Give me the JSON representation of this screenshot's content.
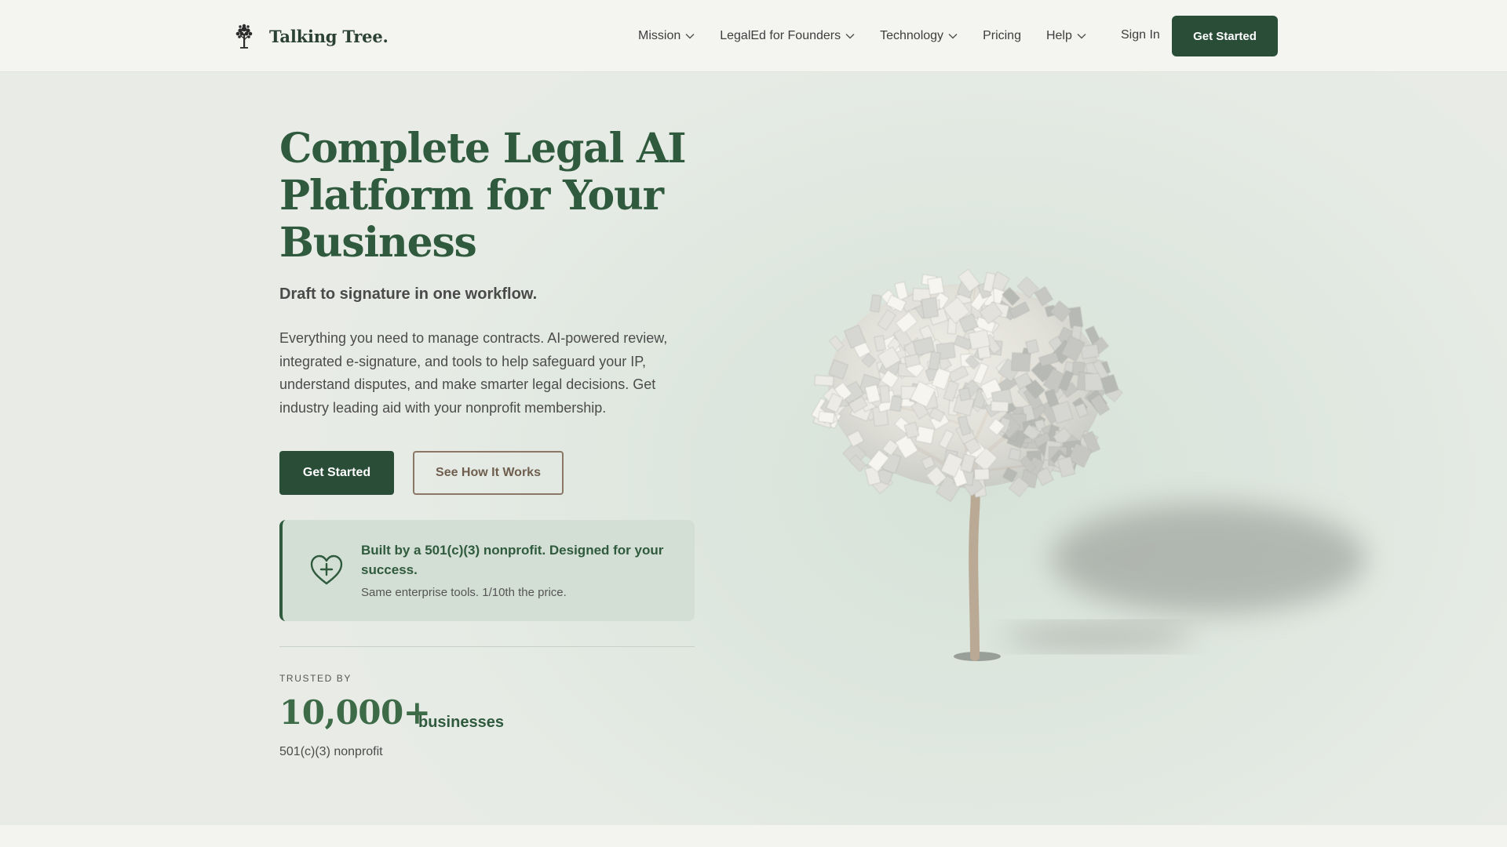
{
  "brand": {
    "name": "Talking Tree.",
    "logo_icon": "tree-icon"
  },
  "nav": {
    "items": [
      {
        "label": "Mission",
        "has_dropdown": true
      },
      {
        "label": "LegalEd for Founders",
        "has_dropdown": true
      },
      {
        "label": "Technology",
        "has_dropdown": true
      },
      {
        "label": "Pricing",
        "has_dropdown": false
      },
      {
        "label": "Help",
        "has_dropdown": true
      }
    ],
    "sign_in": "Sign In",
    "cta": "Get Started"
  },
  "hero": {
    "title": "Complete Legal AI Platform for Your Business",
    "subtitle": "Draft to signature in one workflow.",
    "description": "Everything you need to manage contracts. AI-powered review, integrated e-signature, and tools to help safeguard your IP, understand disputes, and make smarter legal decisions. Get industry leading aid with your nonprofit membership.",
    "primary_button": "Get Started",
    "secondary_button": "See How It Works"
  },
  "nonprofit_card": {
    "icon": "heart-plus-icon",
    "title": "Built by a 501(c)(3) nonprofit. Designed for your success.",
    "subtitle": "Same enterprise tools. 1/10th the price."
  },
  "trusted": {
    "label": "TRUSTED BY",
    "count": "10,000+",
    "unit": "businesses",
    "note": "501(c)(3) nonprofit"
  },
  "colors": {
    "brand_green": "#2a4d38",
    "title_green": "#2f5a3d",
    "secondary_border": "#8a7766",
    "hero_bg": "#dee7df"
  }
}
